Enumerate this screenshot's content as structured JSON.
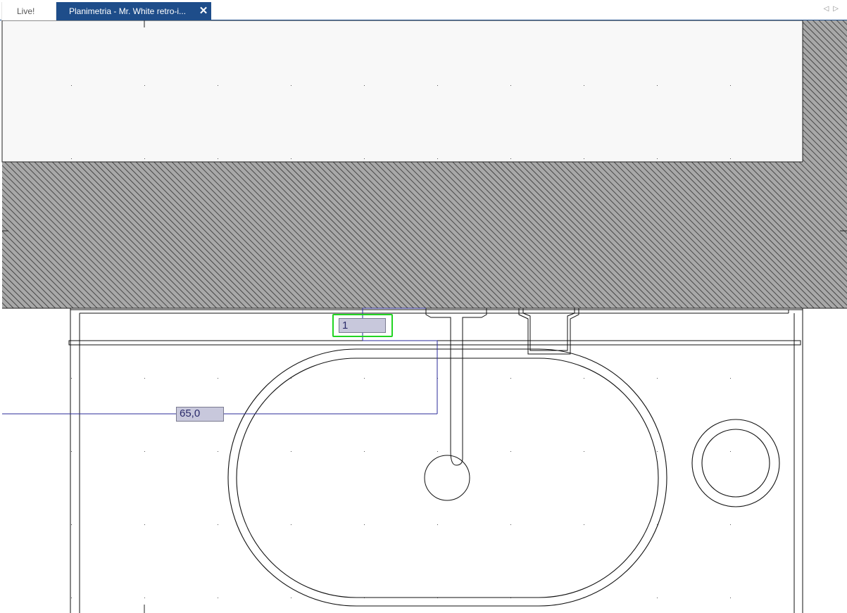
{
  "tabs": [
    {
      "label": "Live!",
      "active": false
    },
    {
      "label": "Planimetria - Mr. White retro-i...",
      "active": true,
      "close_icon": "close-icon"
    }
  ],
  "tab_scroll": {
    "left_icon": "scroll-left-icon",
    "right_icon": "scroll-right-icon",
    "glyphs": "◁▷"
  },
  "canvas": {
    "length_input_value": "1",
    "offset_dimension_label": "65,0"
  },
  "colors": {
    "tab_active_bg": "#1e4d8a",
    "wall_hatch": "#a8a8a8",
    "dimension_line": "#2b2b9a",
    "input_bg": "#c8c8dc",
    "focus_ring": "#22d422"
  }
}
